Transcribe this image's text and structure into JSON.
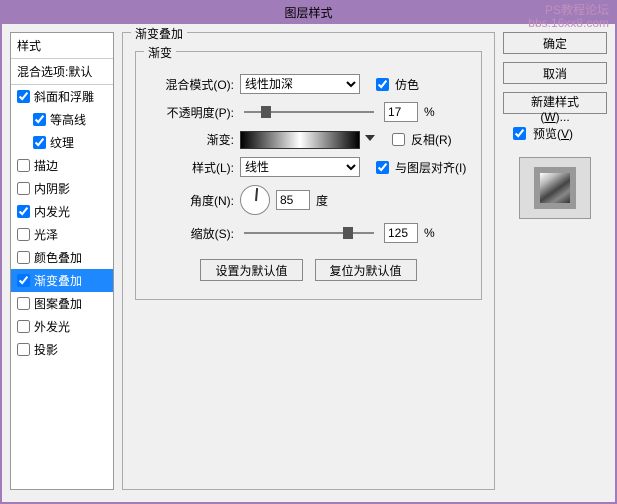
{
  "window": {
    "title": "图层样式"
  },
  "watermark": {
    "line1": "PS教程论坛",
    "line2": "bbs.16xx8.com"
  },
  "left": {
    "header": "样式",
    "sub": "混合选项:默认",
    "items": [
      {
        "label": "斜面和浮雕",
        "checked": true,
        "indent": false
      },
      {
        "label": "等高线",
        "checked": true,
        "indent": true
      },
      {
        "label": "纹理",
        "checked": true,
        "indent": true
      },
      {
        "label": "描边",
        "checked": false,
        "indent": false
      },
      {
        "label": "内阴影",
        "checked": false,
        "indent": false
      },
      {
        "label": "内发光",
        "checked": true,
        "indent": false
      },
      {
        "label": "光泽",
        "checked": false,
        "indent": false
      },
      {
        "label": "颜色叠加",
        "checked": false,
        "indent": false
      },
      {
        "label": "渐变叠加",
        "checked": true,
        "indent": false,
        "selected": true
      },
      {
        "label": "图案叠加",
        "checked": false,
        "indent": false
      },
      {
        "label": "外发光",
        "checked": false,
        "indent": false
      },
      {
        "label": "投影",
        "checked": false,
        "indent": false
      }
    ]
  },
  "center": {
    "group_label": "渐变叠加",
    "sub_label": "渐变",
    "blend_mode_label": "混合模式(O):",
    "blend_mode_value": "线性加深",
    "dither_label": "仿色",
    "opacity_label": "不透明度(P):",
    "opacity_value": "17",
    "percent": "%",
    "gradient_label": "渐变:",
    "reverse_label": "反相(R)",
    "style_label": "样式(L):",
    "style_value": "线性",
    "align_label": "与图层对齐(I)",
    "angle_label": "角度(N):",
    "angle_value": "85",
    "degree": "度",
    "scale_label": "缩放(S):",
    "scale_value": "125",
    "btn_default": "设置为默认值",
    "btn_reset": "复位为默认值"
  },
  "right": {
    "ok": "确定",
    "cancel": "取消",
    "new_style": "新建样式(W)...",
    "preview": "预览(V)"
  }
}
